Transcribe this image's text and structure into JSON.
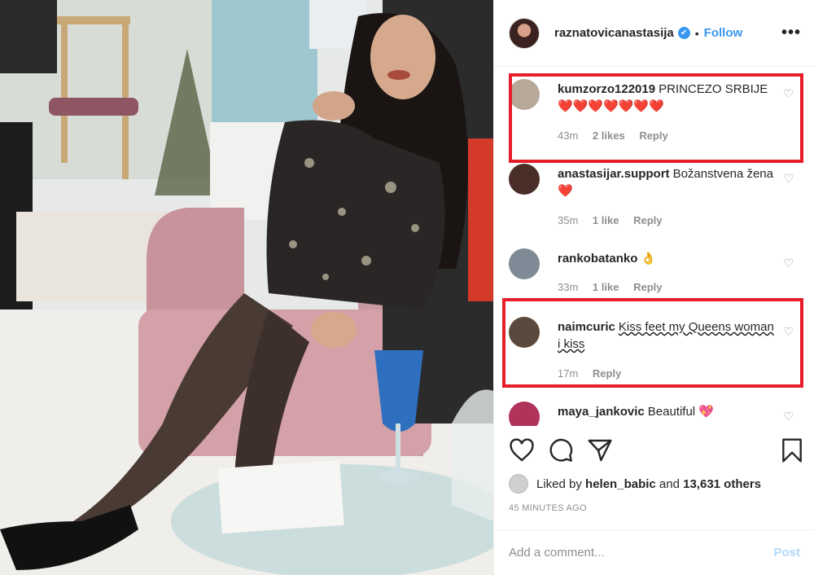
{
  "post": {
    "username": "raznatovicanastasija",
    "verified_mark": "✔",
    "separator": "•",
    "follow_label": "Follow",
    "more_label": "•••"
  },
  "comments": [
    {
      "username": "kumzorzo122019",
      "text": "PRINCEZO SRBIJE❤️❤️❤️❤️❤️❤️❤️",
      "time": "43m",
      "likes": "2 likes",
      "reply": "Reply",
      "avatar_color": "#b8a89a",
      "highlighted": true
    },
    {
      "username": "anastasijar.support",
      "text": "Božanstvena žena ❤️",
      "time": "35m",
      "likes": "1 like",
      "reply": "Reply",
      "avatar_color": "#4a2e28",
      "highlighted": false
    },
    {
      "username": "rankobatanko",
      "text": "👌",
      "time": "33m",
      "likes": "1 like",
      "reply": "Reply",
      "avatar_color": "#7e8a96",
      "highlighted": false
    },
    {
      "username": "naimcuric",
      "text": "Kiss feet my Queens woman i kiss",
      "time": "17m",
      "likes": "",
      "reply": "Reply",
      "avatar_color": "#5a4a3e",
      "highlighted": true
    },
    {
      "username": "maya_jankovic",
      "text": "Beautiful 💖",
      "time": "",
      "likes": "",
      "reply": "",
      "avatar_color": "#b0335a",
      "highlighted": false
    }
  ],
  "icons": {
    "like": "heart-icon",
    "comment": "comment-icon",
    "share": "share-icon",
    "save": "bookmark-icon",
    "comment_like": "♡"
  },
  "liked_by": {
    "prefix": "Liked by",
    "user": "helen_babic",
    "and": "and",
    "others": "13,631 others"
  },
  "timestamp": "45 MINUTES AGO",
  "add_comment": {
    "placeholder": "Add a comment...",
    "post_label": "Post"
  },
  "colors": {
    "accent": "#3897f0",
    "highlight_box": "#e61e2a",
    "muted_text": "#8e8e8e"
  }
}
